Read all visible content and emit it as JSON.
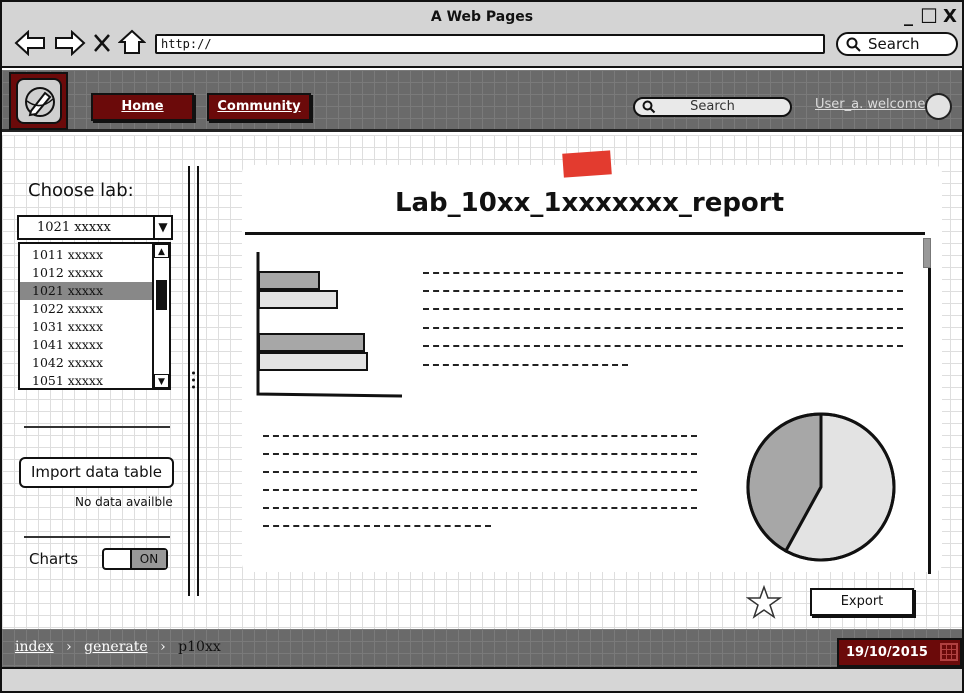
{
  "window": {
    "title": "A Web Pages",
    "controls": [
      "_",
      "☐",
      "X"
    ]
  },
  "browser": {
    "url": "http://",
    "search_label": "Search"
  },
  "header": {
    "nav": [
      {
        "label": "Home"
      },
      {
        "label": "Community"
      }
    ],
    "search_placeholder": "Search",
    "welcome": "User_a. welcome!"
  },
  "sidebar": {
    "choose_label": "Choose lab:",
    "selected": "1021 xxxxx",
    "options": [
      "1011 xxxxx",
      "1012 xxxxx",
      "1021 xxxxx",
      "1022 xxxxx",
      "1031 xxxxx",
      "1041 xxxxx",
      "1042 xxxxx",
      "1051 xxxxx"
    ],
    "import_button": "Import data table",
    "no_data": "No data availble",
    "charts_label": "Charts",
    "charts_toggle": "ON"
  },
  "report": {
    "title": "Lab_10xx_1xxxxxxx_report",
    "bar_values": [
      60,
      78,
      105,
      108
    ],
    "pie_fractions": [
      0.42,
      0.58
    ],
    "colors": {
      "dark_gray": "#a7a7a7",
      "light_gray": "#e3e3e3",
      "accent_red": "#e33b2f",
      "brand": "#6b0a0a"
    }
  },
  "actions": {
    "export": "Export"
  },
  "footer": {
    "breadcrumb": [
      "index",
      "generate",
      "p10xx"
    ],
    "date": "19/10/2015"
  }
}
